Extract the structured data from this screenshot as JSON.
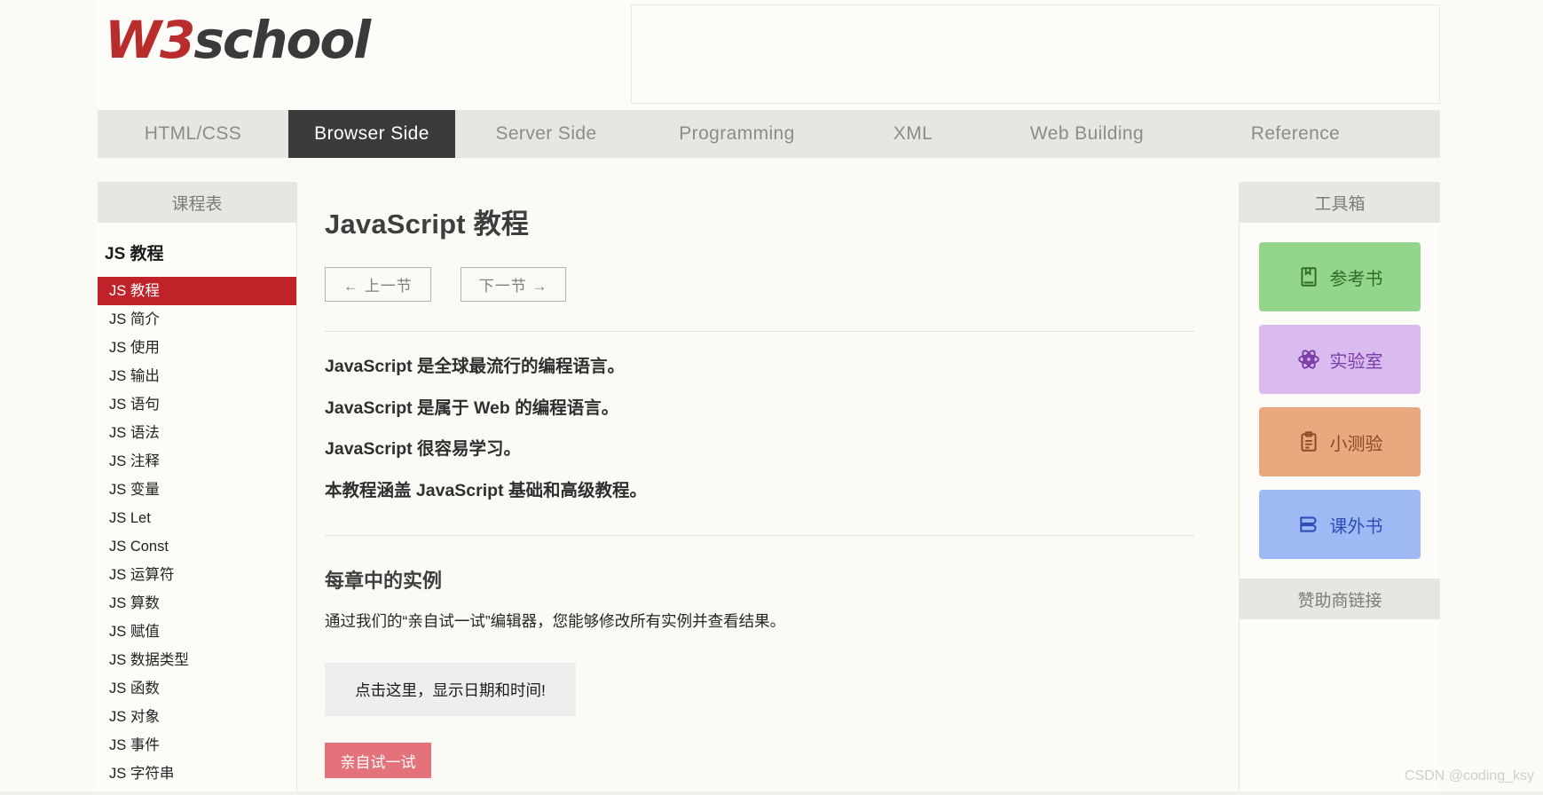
{
  "site": {
    "logo_primary": "W3",
    "logo_secondary": "school",
    "brand_red": "#b92c2c",
    "accent_red": "#bf2229"
  },
  "topnav": {
    "items": [
      {
        "label": "HTML/CSS",
        "active": false
      },
      {
        "label": "Browser Side",
        "active": true
      },
      {
        "label": "Server Side",
        "active": false
      },
      {
        "label": "Programming",
        "active": false
      },
      {
        "label": "XML",
        "active": false
      },
      {
        "label": "Web Building",
        "active": false
      },
      {
        "label": "Reference",
        "active": false
      }
    ]
  },
  "sidebar": {
    "title": "课程表",
    "heading": "JS 教程",
    "items": [
      {
        "label": "JS 教程",
        "active": true
      },
      {
        "label": "JS 简介",
        "active": false
      },
      {
        "label": "JS 使用",
        "active": false
      },
      {
        "label": "JS 输出",
        "active": false
      },
      {
        "label": "JS 语句",
        "active": false
      },
      {
        "label": "JS 语法",
        "active": false
      },
      {
        "label": "JS 注释",
        "active": false
      },
      {
        "label": "JS 变量",
        "active": false
      },
      {
        "label": "JS Let",
        "active": false
      },
      {
        "label": "JS Const",
        "active": false
      },
      {
        "label": "JS 运算符",
        "active": false
      },
      {
        "label": "JS 算数",
        "active": false
      },
      {
        "label": "JS 赋值",
        "active": false
      },
      {
        "label": "JS 数据类型",
        "active": false
      },
      {
        "label": "JS 函数",
        "active": false
      },
      {
        "label": "JS 对象",
        "active": false
      },
      {
        "label": "JS 事件",
        "active": false
      },
      {
        "label": "JS 字符串",
        "active": false
      }
    ]
  },
  "main": {
    "title": "JavaScript 教程",
    "prev_button": "← 上一节",
    "next_button": "下一节 →",
    "lead_paragraphs": [
      "JavaScript 是全球最流行的编程语言。",
      "JavaScript 是属于 Web 的编程语言。",
      "JavaScript 很容易学习。",
      "本教程涵盖 JavaScript 基础和高级教程。"
    ],
    "section_heading": "每章中的实例",
    "section_paragraph": "通过我们的“亲自试一试”编辑器，您能够修改所有实例并查看结果。",
    "demo_text": "点击这里，显示日期和时间!",
    "tryit_button": "亲自试一试"
  },
  "toolbox": {
    "title": "工具箱",
    "items": [
      {
        "label": "参考书",
        "icon": "book-icon",
        "bg": "#91d68a",
        "fg": "#2f6b2a"
      },
      {
        "label": "实验室",
        "icon": "atom-icon",
        "bg": "#d9bbef",
        "fg": "#7a3ca8"
      },
      {
        "label": "小测验",
        "icon": "clipboard-icon",
        "bg": "#eaa87e",
        "fg": "#8a4a24"
      },
      {
        "label": "课外书",
        "icon": "books-icon",
        "bg": "#9fb9f5",
        "fg": "#2c4fb5"
      }
    ],
    "sponsor_title": "赞助商链接"
  },
  "watermark": "CSDN @coding_ksy"
}
